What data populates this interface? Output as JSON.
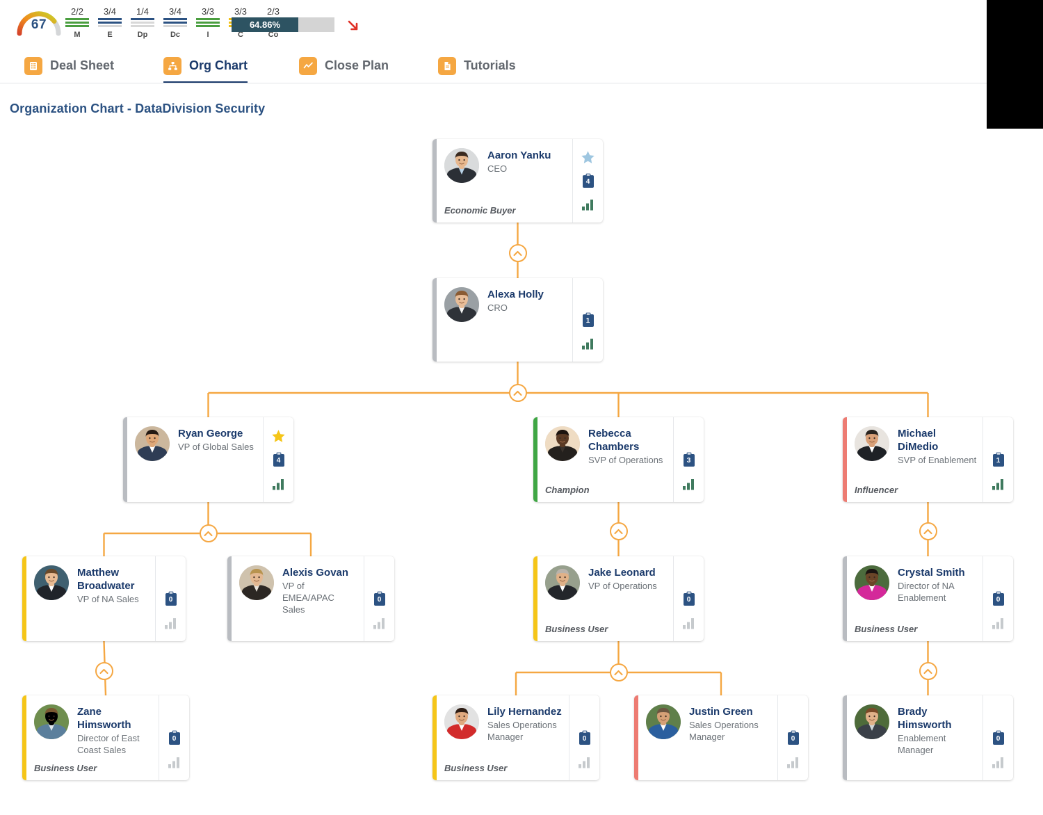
{
  "header": {
    "gauge": {
      "value": "67",
      "arc_percent": 67
    },
    "meddpicc": [
      {
        "key": "M",
        "fraction": "2/2",
        "filled": 3,
        "color": "#4a9e3f"
      },
      {
        "key": "E",
        "fraction": "3/4",
        "filled": 2,
        "color": "#2c5282"
      },
      {
        "key": "Dp",
        "fraction": "1/4",
        "filled": 1,
        "color": "#2c5282"
      },
      {
        "key": "Dc",
        "fraction": "3/4",
        "filled": 2,
        "color": "#2c5282"
      },
      {
        "key": "I",
        "fraction": "3/3",
        "filled": 3,
        "color": "#4a9e3f"
      },
      {
        "key": "C",
        "fraction": "3/3",
        "filled": 3,
        "color": "#f2c014"
      },
      {
        "key": "Co",
        "fraction": "2/3",
        "filled": 2,
        "color": "#d93025"
      }
    ],
    "progress": {
      "label": "64.86%",
      "percent": 64.86,
      "fill_color": "#2d5362",
      "track_color": "#d4d4d4"
    },
    "trend": {
      "icon": "arrow-down-right-icon",
      "color": "#e03127"
    }
  },
  "tabs": [
    {
      "label": "Deal Sheet",
      "icon": "deal-sheet-icon",
      "active": false
    },
    {
      "label": "Org Chart",
      "icon": "org-chart-icon",
      "active": true
    },
    {
      "label": "Close Plan",
      "icon": "close-plan-icon",
      "active": false
    },
    {
      "label": "Tutorials",
      "icon": "tutorials-icon",
      "active": false
    }
  ],
  "page_title": "Organization Chart - DataDivision Security",
  "chart_data": {
    "type": "diagram",
    "title": "Organization Chart - DataDivision Security",
    "accent_legend": {
      "gray": "#b9bcc1",
      "green": "#3fa644",
      "yellow": "#f5c518",
      "red": "#ed7b72"
    },
    "nodes": [
      {
        "id": "aaron",
        "name": "Aaron Yanku",
        "title": "CEO",
        "role": "Economic Buyer",
        "accent": "#b9bcc1",
        "star": "light",
        "badge": "4",
        "badge_style": "solid",
        "signal": "dark",
        "avatar": "male-1"
      },
      {
        "id": "alexa",
        "name": "Alexa Holly",
        "title": "CRO",
        "role": "",
        "accent": "#b9bcc1",
        "star": "none",
        "badge": "1",
        "badge_style": "solid",
        "signal": "dark",
        "avatar": "female-1"
      },
      {
        "id": "ryan",
        "name": "Ryan George",
        "title": "VP of Global Sales",
        "role": "",
        "accent": "#b9bcc1",
        "star": "gold",
        "badge": "4",
        "badge_style": "solid",
        "signal": "dark",
        "avatar": "male-2"
      },
      {
        "id": "rebecca",
        "name": "Rebecca Chambers",
        "title": "SVP of Operations",
        "role": "Champion",
        "accent": "#3fa644",
        "star": "none",
        "badge": "3",
        "badge_style": "solid",
        "signal": "dark",
        "avatar": "female-2"
      },
      {
        "id": "michael",
        "name": "Michael DiMedio",
        "title": "SVP of Enablement",
        "role": "Influencer",
        "accent": "#ed7b72",
        "star": "none",
        "badge": "1",
        "badge_style": "solid",
        "signal": "dark",
        "avatar": "male-3"
      },
      {
        "id": "matthew",
        "name": "Matthew Broadwater",
        "title": "VP of NA Sales",
        "role": "",
        "accent": "#f5c518",
        "star": "none",
        "badge": "0",
        "badge_style": "solid",
        "signal": "gray",
        "avatar": "male-4"
      },
      {
        "id": "alexis",
        "name": "Alexis Govan",
        "title": "VP of EMEA/APAC Sales",
        "role": "",
        "accent": "#b9bcc1",
        "star": "none",
        "badge": "0",
        "badge_style": "solid",
        "signal": "gray",
        "avatar": "female-3"
      },
      {
        "id": "jake",
        "name": "Jake Leonard",
        "title": "VP of Operations",
        "role": "Business User",
        "accent": "#f5c518",
        "star": "none",
        "badge": "0",
        "badge_style": "solid",
        "signal": "gray",
        "avatar": "male-5"
      },
      {
        "id": "crystal",
        "name": "Crystal Smith",
        "title": "Director of NA Enablement",
        "role": "Business User",
        "accent": "#b9bcc1",
        "star": "none",
        "badge": "0",
        "badge_style": "solid",
        "signal": "gray",
        "avatar": "female-4"
      },
      {
        "id": "zane",
        "name": "Zane Himsworth",
        "title": "Director of East Coast Sales",
        "role": "Business User",
        "accent": "#f5c518",
        "star": "none",
        "badge": "0",
        "badge_style": "solid",
        "signal": "gray",
        "avatar": "male-6"
      },
      {
        "id": "lily",
        "name": "Lily Hernandez",
        "title": "Sales Operations Manager",
        "role": "Business User",
        "accent": "#f5c518",
        "star": "none",
        "badge": "0",
        "badge_style": "solid",
        "signal": "gray",
        "avatar": "female-5"
      },
      {
        "id": "justin",
        "name": "Justin Green",
        "title": "Sales Operations Manager",
        "role": "",
        "accent": "#ed7b72",
        "star": "none",
        "badge": "0",
        "badge_style": "solid",
        "signal": "gray",
        "avatar": "male-7"
      },
      {
        "id": "brady",
        "name": "Brady Himsworth",
        "title": "Enablement Manager",
        "role": "",
        "accent": "#b9bcc1",
        "star": "none",
        "badge": "0",
        "badge_style": "solid",
        "signal": "gray",
        "avatar": "male-8"
      }
    ],
    "edges": [
      {
        "from": "aaron",
        "to": "alexa"
      },
      {
        "from": "alexa",
        "to": "ryan"
      },
      {
        "from": "alexa",
        "to": "rebecca"
      },
      {
        "from": "alexa",
        "to": "michael"
      },
      {
        "from": "ryan",
        "to": "matthew"
      },
      {
        "from": "ryan",
        "to": "alexis"
      },
      {
        "from": "rebecca",
        "to": "jake"
      },
      {
        "from": "michael",
        "to": "crystal"
      },
      {
        "from": "matthew",
        "to": "zane"
      },
      {
        "from": "jake",
        "to": "lily"
      },
      {
        "from": "jake",
        "to": "justin"
      },
      {
        "from": "crystal",
        "to": "brady"
      }
    ],
    "connector_color": "#f5a742"
  }
}
